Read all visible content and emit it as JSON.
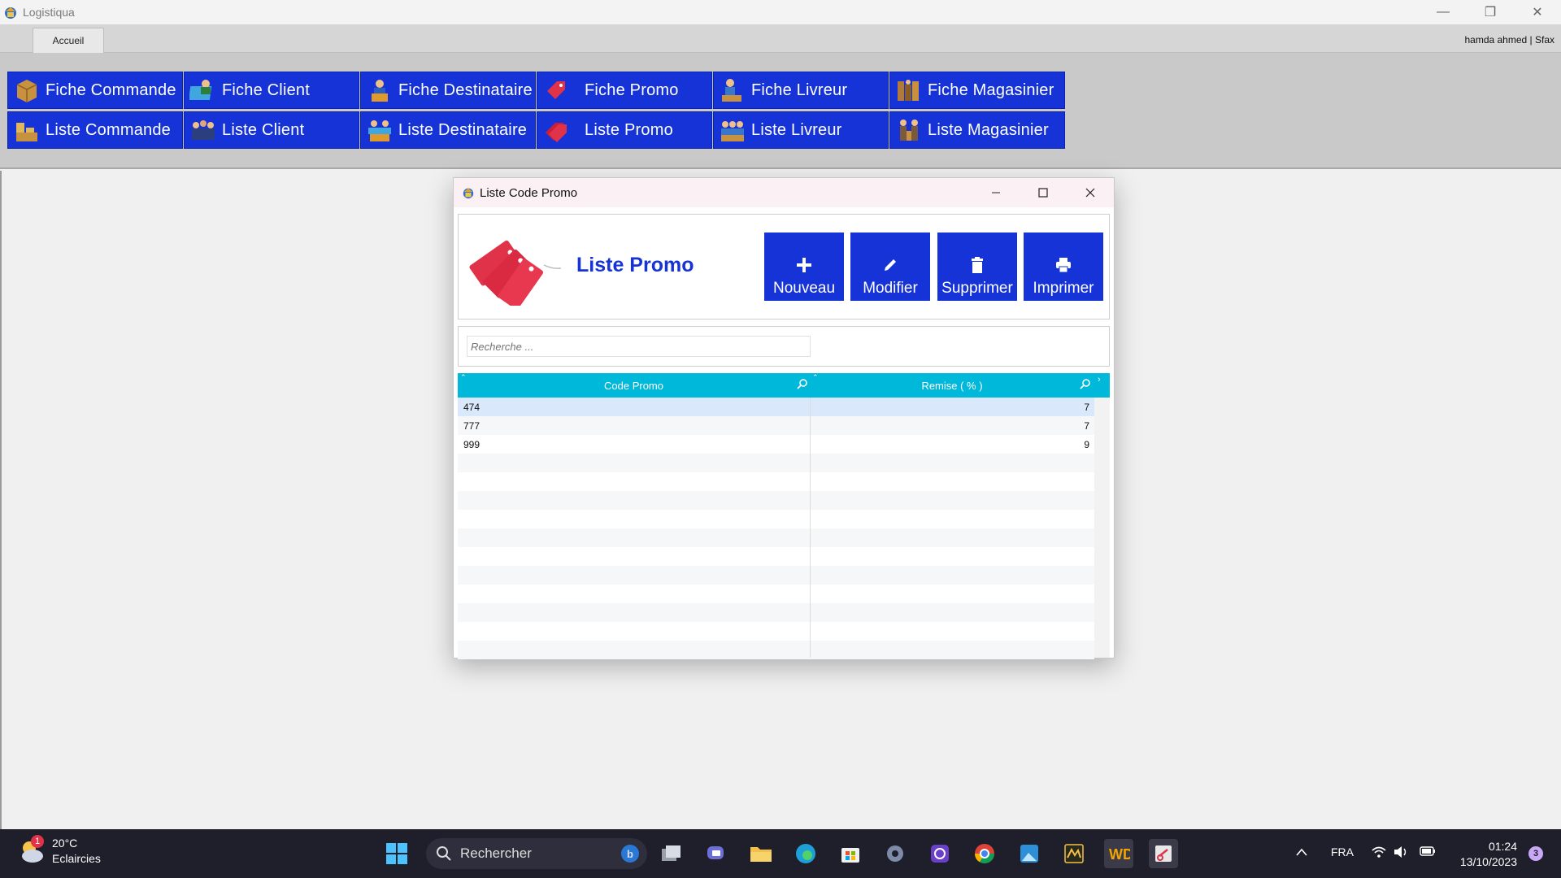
{
  "app": {
    "title": "Logistiqua",
    "user": "hamda ahmed | Sfax",
    "tab": "Accueil",
    "controls": [
      "—",
      "❐",
      "✕"
    ]
  },
  "tiles": {
    "row1": [
      "Fiche Commande",
      "Fiche Client",
      "Fiche Destinataire",
      "Fiche Promo",
      "Fiche Livreur",
      "Fiche Magasinier"
    ],
    "row2": [
      "Liste Commande",
      "Liste Client",
      "Liste Destinataire",
      "Liste Promo",
      "Liste Livreur",
      "Liste Magasinier"
    ]
  },
  "dialog": {
    "title": "Liste Code Promo",
    "heading": "Liste Promo",
    "buttons": {
      "new": "Nouveau",
      "edit": "Modifier",
      "delete": "Supprimer",
      "print": "Imprimer"
    },
    "search_placeholder": "Recherche ...",
    "columns": [
      "Code Promo",
      "Remise ( % )"
    ],
    "rows": [
      {
        "code": "474",
        "remise": "7"
      },
      {
        "code": "777",
        "remise": "7"
      },
      {
        "code": "999",
        "remise": "9"
      }
    ]
  },
  "taskbar": {
    "temperature": "20°C",
    "weather": "Eclaircies",
    "weather_badge": "1",
    "search": "Rechercher",
    "language": "FRA",
    "time": "01:24",
    "date": "13/10/2023",
    "notifications": "3"
  },
  "colors": {
    "tile_blue": "#1533d6",
    "grid_header": "#00b8d9",
    "selected_row": "#d9e8fb"
  }
}
